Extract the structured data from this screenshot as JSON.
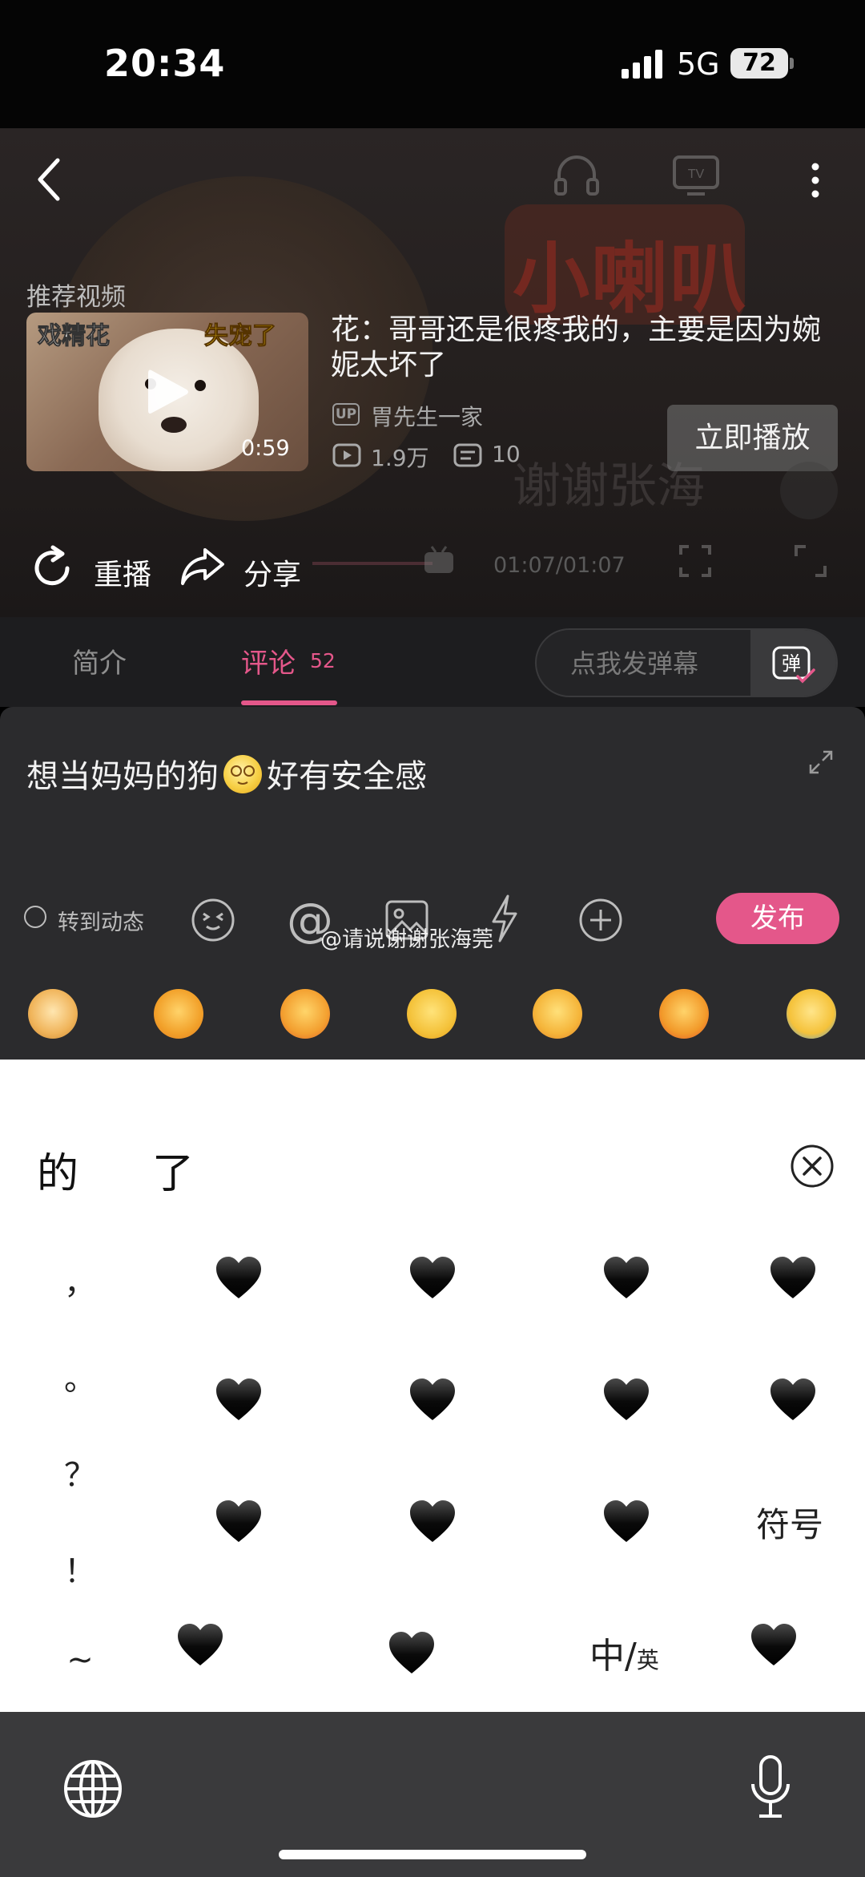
{
  "status": {
    "time": "20:34",
    "network": "5G",
    "battery": "72"
  },
  "player": {
    "recommend_label": "推荐视频",
    "thumbnail": {
      "tag_left": "戏精花",
      "tag_right": "失宠了",
      "duration": "0:59"
    },
    "video_title": "花：哥哥还是很疼我的，主要是因为婉妮太坏了",
    "up_badge": "UP",
    "uploader": "胃先生一家",
    "views": "1.9万",
    "danmaku_count": "10",
    "play_now": "立即播放",
    "replay": "重播",
    "share": "分享",
    "time_code": "01:07/01:07",
    "bg_logo": "小喇叭",
    "bg_watermark": "谢谢张海"
  },
  "tabs": {
    "intro": "简介",
    "comments": "评论",
    "comments_count": "52",
    "danmaku_placeholder": "点我发弹幕"
  },
  "composer": {
    "text_before": "想当妈妈的狗",
    "text_after": "好有安全感",
    "repost_label": "转到动态",
    "at_symbol": "@",
    "watermark": "@请说谢谢张海莞",
    "publish": "发布"
  },
  "keyboard": {
    "candidates": [
      "的",
      "了"
    ],
    "punctuation": [
      "，",
      "。",
      "？",
      "！",
      "~"
    ],
    "symbols_key": "符号",
    "lang_key_main": "中/",
    "lang_key_sub": "英"
  },
  "colors": {
    "accent": "#e4578a",
    "panel": "#2b2b2d",
    "tabbar": "#1d1d1f"
  }
}
